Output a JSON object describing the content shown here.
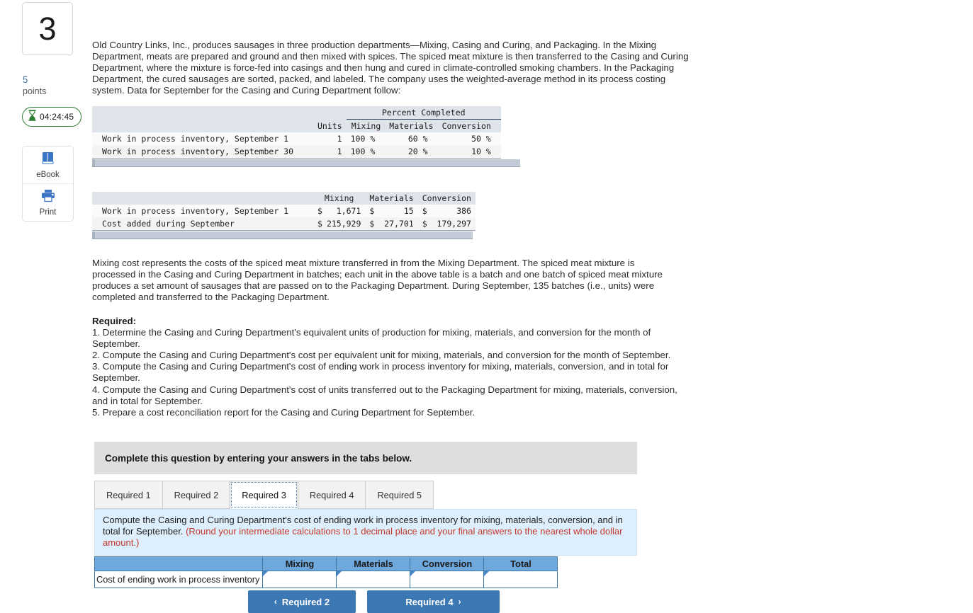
{
  "sidebar": {
    "question_number": "3",
    "points_value": "5",
    "points_label": "points",
    "timer": "04:24:45",
    "ebook_label": "eBook",
    "print_label": "Print"
  },
  "intro_paragraph": "Old Country Links, Inc., produces sausages in three production departments—Mixing, Casing and Curing, and Packaging. In the Mixing Department, meats are prepared and ground and then mixed with spices. The spiced meat mixture is then transferred to the Casing and Curing Department, where the mixture is force-fed into casings and then hung and cured in climate-controlled smoking chambers. In the Packaging Department, the cured sausages are sorted, packed, and labeled. The company uses the weighted-average method in its process costing system. Data for September for the Casing and Curing Department follow:",
  "units_table": {
    "span_header": "Percent Completed",
    "columns": [
      "Units",
      "Mixing",
      "Materials",
      "Conversion"
    ],
    "rows": [
      {
        "label": "Work in process inventory, September 1",
        "units": "1",
        "mixing": "100 %",
        "materials": "60 %",
        "conversion": "50 %"
      },
      {
        "label": "Work in process inventory, September 30",
        "units": "1",
        "mixing": "100 %",
        "materials": "20 %",
        "conversion": "10 %"
      }
    ]
  },
  "cost_table": {
    "columns": [
      "Mixing",
      "Materials",
      "Conversion"
    ],
    "rows": [
      {
        "label": "Work in process inventory, September 1",
        "mixing_sym": "$",
        "mixing": "1,671",
        "materials_sym": "$",
        "materials": "15",
        "conversion_sym": "$",
        "conversion": "386"
      },
      {
        "label": "Cost added during September",
        "mixing_sym": "$",
        "mixing": "215,929",
        "materials_sym": "$",
        "materials": "27,701",
        "conversion_sym": "$",
        "conversion": "179,297"
      }
    ]
  },
  "mid_paragraph": "Mixing cost represents the costs of the spiced meat mixture transferred in from the Mixing Department. The spiced meat mixture is processed in the Casing and Curing Department in batches; each unit in the above table is a batch and one batch of spiced meat mixture produces a set amount of sausages that are passed on to the Packaging Department. During September, 135 batches (i.e., units) were completed and transferred to the Packaging Department.",
  "required": {
    "title": "Required:",
    "items": [
      "1. Determine the Casing and Curing Department's equivalent units of production for mixing, materials, and conversion for the month of September.",
      "2. Compute the Casing and Curing Department's cost per equivalent unit for mixing, materials, and conversion for the month of September.",
      "3. Compute the Casing and Curing Department's cost of ending work in process inventory for mixing, materials, conversion, and in total for September.",
      "4. Compute the Casing and Curing Department's cost of units transferred out to the Packaging Department for mixing, materials, conversion, and in total for September.",
      "5. Prepare a cost reconciliation report for the Casing and Curing Department for September."
    ]
  },
  "grey_banner": "Complete this question by entering your answers in the tabs below.",
  "tabs": [
    {
      "label": "Required 1",
      "active": false
    },
    {
      "label": "Required 2",
      "active": false
    },
    {
      "label": "Required 3",
      "active": true
    },
    {
      "label": "Required 4",
      "active": false
    },
    {
      "label": "Required 5",
      "active": false
    }
  ],
  "blue_panel": {
    "text": "Compute the Casing and Curing Department's cost of ending work in process inventory for mixing, materials, conversion, and in total for September. ",
    "note": "(Round your intermediate calculations to 1 decimal place and your final answers to the nearest whole dollar amount.)"
  },
  "answer_grid": {
    "corner_label": "",
    "columns": [
      "Mixing",
      "Materials",
      "Conversion",
      "Total"
    ],
    "row_label": "Cost of ending work in process inventory",
    "values": [
      "",
      "",
      "",
      ""
    ]
  },
  "nav": {
    "prev_label": "Required 2",
    "next_label": "Required 4",
    "prev_chevron": "‹",
    "next_chevron": "›"
  },
  "colors": {
    "accent_blue": "#3c78b4",
    "header_blue": "#6fa8dc",
    "panel_blue": "#ddeefc",
    "note_red": "#c0392b",
    "timer_green": "#2e7d32"
  }
}
